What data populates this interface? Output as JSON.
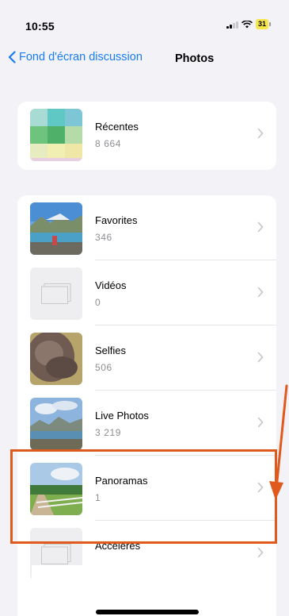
{
  "status": {
    "time": "10:55",
    "battery": "31"
  },
  "nav": {
    "back_label": "Fond d'écran discussion",
    "title": "Photos"
  },
  "recent": {
    "title": "Récentes",
    "count": "8 664"
  },
  "albums": [
    {
      "title": "Favorites",
      "count": "346"
    },
    {
      "title": "Vidéos",
      "count": "0"
    },
    {
      "title": "Selfies",
      "count": "506"
    },
    {
      "title": "Live Photos",
      "count": "3 219"
    },
    {
      "title": "Panoramas",
      "count": "1"
    },
    {
      "title": "Accélérés",
      "count": ""
    }
  ],
  "colors": {
    "accent": "#1a7cf5",
    "annotation": "#e0591d",
    "background": "#f2f2f7"
  }
}
